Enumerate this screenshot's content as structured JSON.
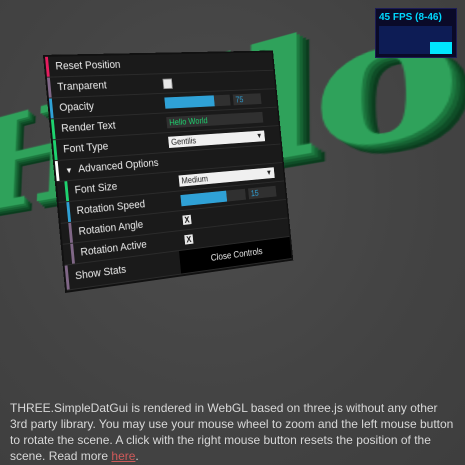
{
  "scene": {
    "text_3d": "Hello World!",
    "text_color": "#2fa25b",
    "background_color": "#454545"
  },
  "stats": {
    "fps_label": "45 FPS (8-46)",
    "fps": 45,
    "fps_min": 8,
    "fps_max": 46
  },
  "gui": {
    "rows": {
      "reset": "Reset Position",
      "transparent": "Tranparent",
      "opacity": "Opacity",
      "opacity_value": "75",
      "render_text": "Render Text",
      "render_text_value": "Hello World",
      "font_type": "Font Type",
      "font_type_value": "Gentilis",
      "advanced": "Advanced Options",
      "font_size": "Font Size",
      "font_size_value": "Medium",
      "rotation_speed": "Rotation Speed",
      "rotation_speed_value": "15",
      "rotation_angle": "Rotation Angle",
      "rotation_active": "Rotation Active",
      "show_stats": "Show Stats",
      "close_controls": "Close Controls"
    },
    "opacity_fraction": 0.75,
    "rotation_speed_fraction": 0.7,
    "checkmark": "X",
    "colors": {
      "button_stripe": "#e61d5f",
      "boolean_stripe": "#806787",
      "number_stripe": "#2fa1d6",
      "string_stripe": "#1ed36f",
      "folder_stripe": "#ffffff"
    }
  },
  "info": {
    "text": "THREE.SimpleDatGui is rendered in WebGL based on three.js without any other 3rd party library. You may use your mouse wheel to zoom and the left mouse button to rotate the scene. A click with the right mouse button resets the position of the scene. Read more ",
    "link_text": "here",
    "after_link": "."
  }
}
